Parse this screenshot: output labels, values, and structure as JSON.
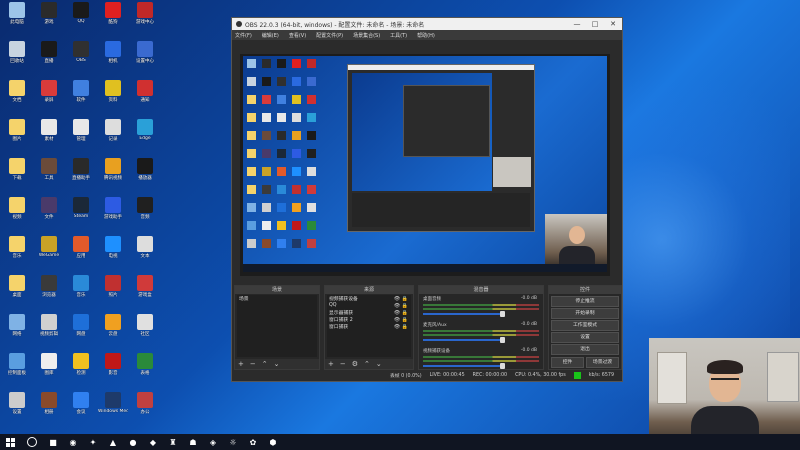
{
  "desktop": {
    "icons": [
      {
        "label": "此电脑",
        "color": "#9cc4e8"
      },
      {
        "label": "回收站",
        "color": "#c8d4e0"
      },
      {
        "label": "文档",
        "color": "#f5d36b"
      },
      {
        "label": "图片",
        "color": "#f5d36b"
      },
      {
        "label": "下载",
        "color": "#f5d36b"
      },
      {
        "label": "视频",
        "color": "#f5d36b"
      },
      {
        "label": "音乐",
        "color": "#f5d36b"
      },
      {
        "label": "桌面",
        "color": "#f5d36b"
      },
      {
        "label": "网络",
        "color": "#7fb2e5"
      },
      {
        "label": "控制面板",
        "color": "#5a9ee0"
      },
      {
        "label": "设置",
        "color": "#cccccc"
      },
      {
        "label": "游戏",
        "color": "#2b2b2b"
      },
      {
        "label": "直播",
        "color": "#1a1a1a"
      },
      {
        "label": "录屏",
        "color": "#d93b3b"
      },
      {
        "label": "素材",
        "color": "#e8e8e8"
      },
      {
        "label": "工具",
        "color": "#6b4b3a"
      },
      {
        "label": "文件",
        "color": "#4a3a6a"
      },
      {
        "label": "WeGame",
        "color": "#c9a227"
      },
      {
        "label": "浏览器",
        "color": "#3a3a3a"
      },
      {
        "label": "视频剪辑",
        "color": "#d0d0d0"
      },
      {
        "label": "图库",
        "color": "#eee"
      },
      {
        "label": "相册",
        "color": "#8a4a2a"
      },
      {
        "label": "QQ",
        "color": "#1a1a1a"
      },
      {
        "label": "OBS",
        "color": "#303030"
      },
      {
        "label": "软件",
        "color": "#4080e0"
      },
      {
        "label": "管理",
        "color": "#e8e8e8"
      },
      {
        "label": "直播助手",
        "color": "#2a2a2a"
      },
      {
        "label": "Steam",
        "color": "#1b2838"
      },
      {
        "label": "应用",
        "color": "#e25a2a"
      },
      {
        "label": "音乐",
        "color": "#2a8ad8"
      },
      {
        "label": "网盘",
        "color": "#1e6fd9"
      },
      {
        "label": "检测",
        "color": "#f0c020"
      },
      {
        "label": "会议",
        "color": "#3080f0"
      },
      {
        "label": "酷狗",
        "color": "#e02020"
      },
      {
        "label": "相机",
        "color": "#2a6ae0"
      },
      {
        "label": "资料",
        "color": "#e0c020"
      },
      {
        "label": "记录",
        "color": "#ddd"
      },
      {
        "label": "腾讯视频",
        "color": "#e8a020"
      },
      {
        "label": "游戏助手",
        "color": "#2d5be3"
      },
      {
        "label": "电视",
        "color": "#1e90ff"
      },
      {
        "label": "照片",
        "color": "#c03030"
      },
      {
        "label": "云盘",
        "color": "#f0a020"
      },
      {
        "label": "影音",
        "color": "#c01818"
      },
      {
        "label": "Windows Media",
        "color": "#1e3a6a"
      },
      {
        "label": "游戏中心",
        "color": "#c02828"
      },
      {
        "label": "设置中心",
        "color": "#3a6ad0"
      },
      {
        "label": "通知",
        "color": "#d03030"
      },
      {
        "label": "Edge",
        "color": "#2aa0d8"
      },
      {
        "label": "播放器",
        "color": "#1a1a1a"
      },
      {
        "label": "音频",
        "color": "#202020"
      },
      {
        "label": "文本",
        "color": "#ddd"
      },
      {
        "label": "游戏盒",
        "color": "#d03a3a"
      },
      {
        "label": "社区",
        "color": "#e0e0e0"
      },
      {
        "label": "表格",
        "color": "#2a8a3a"
      },
      {
        "label": "办公",
        "color": "#c04040"
      }
    ]
  },
  "taskbar": {
    "start_icon": "windows-logo",
    "items": [
      "■",
      "◉",
      "✦",
      "▲",
      "●",
      "◆",
      "♜",
      "☗",
      "◈",
      "☼",
      "✿",
      "⬢"
    ]
  },
  "obs": {
    "title": "OBS 22.0.3 (64-bit, windows) - 配置文件: 未命名 - 场景: 未命名",
    "window_controls": [
      "—",
      "□",
      "✕"
    ],
    "menu": [
      "文件(F)",
      "编辑(E)",
      "查看(V)",
      "配置文件(P)",
      "场景集合(S)",
      "工具(T)",
      "帮助(H)"
    ],
    "scenes": {
      "header": "场景",
      "items": [
        "场景"
      ]
    },
    "sources": {
      "header": "来源",
      "items": [
        "视频捕获设备",
        "QQ",
        "显示器捕获",
        "窗口捕获 2",
        "窗口捕获"
      ]
    },
    "mixer": {
      "header": "混音器",
      "tracks": [
        {
          "name": "桌面音频",
          "db": "-0.0 dB"
        },
        {
          "name": "麦克风/Aux",
          "db": "-0.0 dB"
        },
        {
          "name": "视频捕获设备",
          "db": "-0.0 dB"
        }
      ]
    },
    "controls": {
      "header": "控件",
      "buttons": [
        "停止推流",
        "开始录制",
        "工作室模式",
        "设置",
        "退出"
      ],
      "tabs": [
        "控件",
        "场景过渡"
      ]
    },
    "status": {
      "dropped": "丢帧 0 (0.0%)",
      "live": "LIVE: 00:00:45",
      "rec": "REC: 00:00:00",
      "cpu": "CPU: 0.4%, 30.00 fps",
      "kbps": "kb/s: 6579",
      "indicator_color": "#19c219"
    }
  }
}
